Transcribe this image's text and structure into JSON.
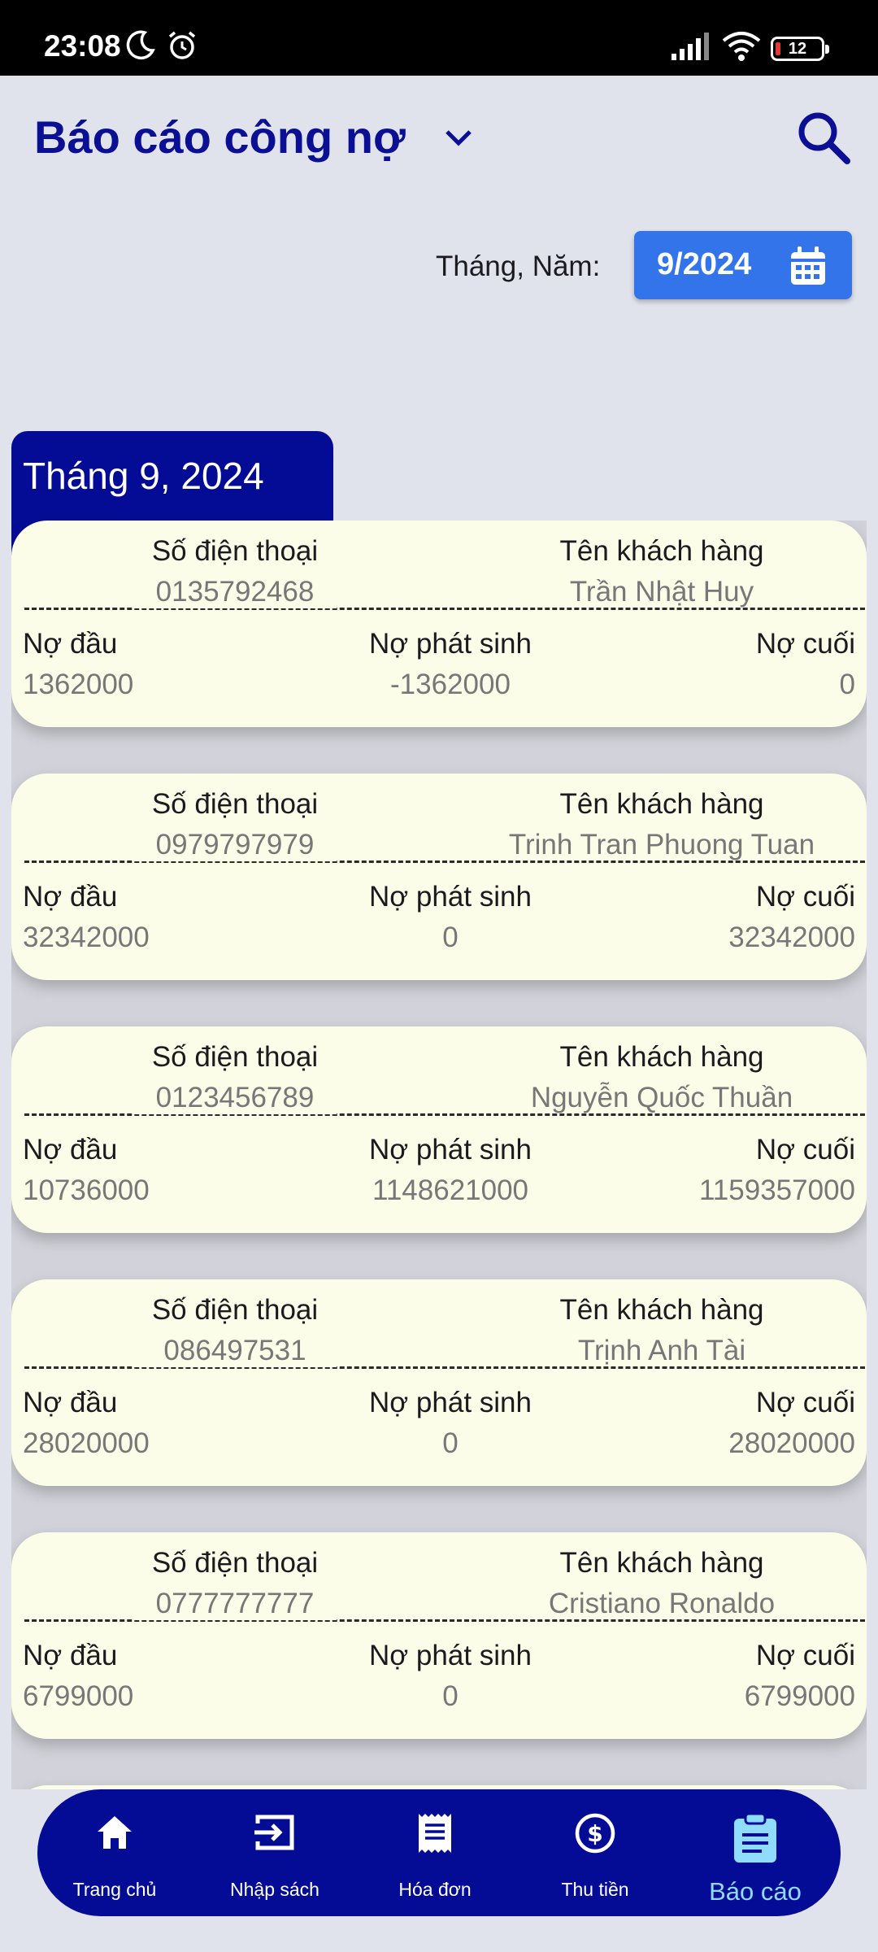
{
  "status_bar": {
    "time": "23:08",
    "battery": "12",
    "icons": [
      "moon-icon",
      "alarm-icon",
      "signal-icon",
      "wifi-icon",
      "battery-icon"
    ]
  },
  "header": {
    "title": "Báo cáo công nợ",
    "icons": [
      "chevron-down-icon",
      "search-icon"
    ]
  },
  "filter": {
    "label": "Tháng, Năm:",
    "value": "9/2024",
    "icon": "calendar-icon"
  },
  "month_section": {
    "title": "Tháng 9, 2024"
  },
  "labels": {
    "phone": "Số điện thoại",
    "name": "Tên khách hàng",
    "opening": "Nợ đầu",
    "arising": "Nợ phát sinh",
    "closing": "Nợ cuối"
  },
  "records": [
    {
      "phone": "0135792468",
      "name": "Trần Nhật Huy",
      "opening": "1362000",
      "arising": "-1362000",
      "closing": "0"
    },
    {
      "phone": "0979797979",
      "name": "Trinh Tran Phuong Tuan",
      "opening": "32342000",
      "arising": "0",
      "closing": "32342000"
    },
    {
      "phone": "0123456789",
      "name": "Nguyễn Quốc Thuần",
      "opening": "10736000",
      "arising": "1148621000",
      "closing": "1159357000"
    },
    {
      "phone": "086497531",
      "name": "Trịnh Anh Tài",
      "opening": "28020000",
      "arising": "0",
      "closing": "28020000"
    },
    {
      "phone": "0777777777",
      "name": "Cristiano Ronaldo",
      "opening": "6799000",
      "arising": "0",
      "closing": "6799000"
    }
  ],
  "bottom_nav": {
    "items": [
      {
        "label": "Trang chủ",
        "icon": "home-icon"
      },
      {
        "label": "Nhập sách",
        "icon": "import-icon"
      },
      {
        "label": "Hóa đơn",
        "icon": "receipt-icon"
      },
      {
        "label": "Thu tiền",
        "icon": "dollar-icon"
      },
      {
        "label": "Báo cáo",
        "icon": "report-icon",
        "active": true
      }
    ]
  },
  "colors": {
    "primary": "#040c96",
    "accent": "#3374ea",
    "card": "#fcfde8",
    "background": "#e0e2ec",
    "active_nav": "#8fdcff"
  }
}
